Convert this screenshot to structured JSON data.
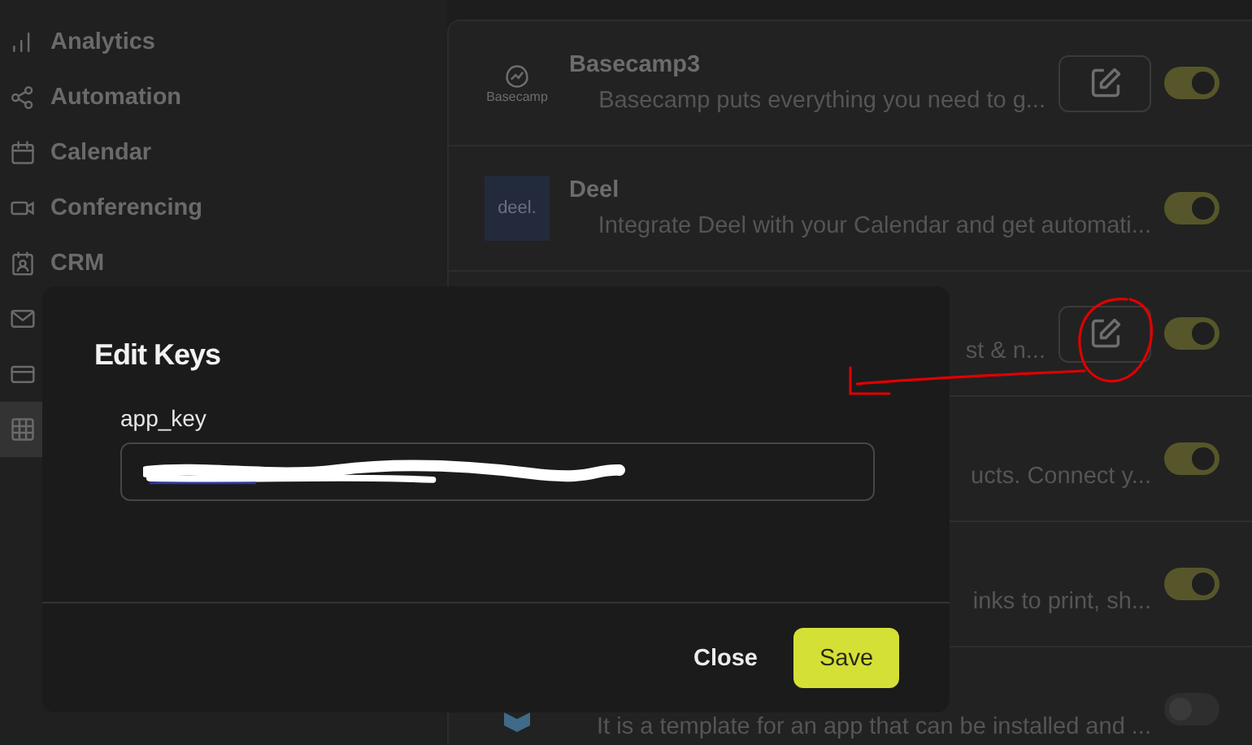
{
  "sidebar": {
    "items": [
      {
        "label": "Analytics",
        "selected": false
      },
      {
        "label": "Automation",
        "selected": false
      },
      {
        "label": "Calendar",
        "selected": false
      },
      {
        "label": "Conferencing",
        "selected": false
      },
      {
        "label": "CRM",
        "selected": false
      },
      {
        "selected": false
      },
      {
        "selected": false
      },
      {
        "selected": true
      }
    ]
  },
  "apps": [
    {
      "logo": {
        "kind": "basecamp",
        "text": "Basecamp"
      },
      "title": "Basecamp3",
      "description": "Basecamp puts everything you need to g...",
      "edit": true,
      "on": true
    },
    {
      "logo": {
        "kind": "deel",
        "text": "deel."
      },
      "title": "Deel",
      "description": "Integrate Deel with your Calendar and get automati...",
      "edit": false,
      "on": true
    },
    {
      "description": "st & n...",
      "edit": true,
      "on": true
    },
    {
      "description": "ucts. Connect y...",
      "edit": false,
      "on": true
    },
    {
      "description": "inks to print, sh...",
      "edit": false,
      "on": true
    },
    {
      "logo": {
        "kind": "cube"
      },
      "description": "It is a template for an app that can be installed and ...",
      "edit": false,
      "on": false
    }
  ],
  "dialog": {
    "title": "Edit Keys",
    "field": {
      "label": "app_key"
    },
    "buttons": [
      {
        "label": "Close",
        "kind": "secondary"
      },
      {
        "label": "Save",
        "kind": "primary"
      }
    ]
  }
}
